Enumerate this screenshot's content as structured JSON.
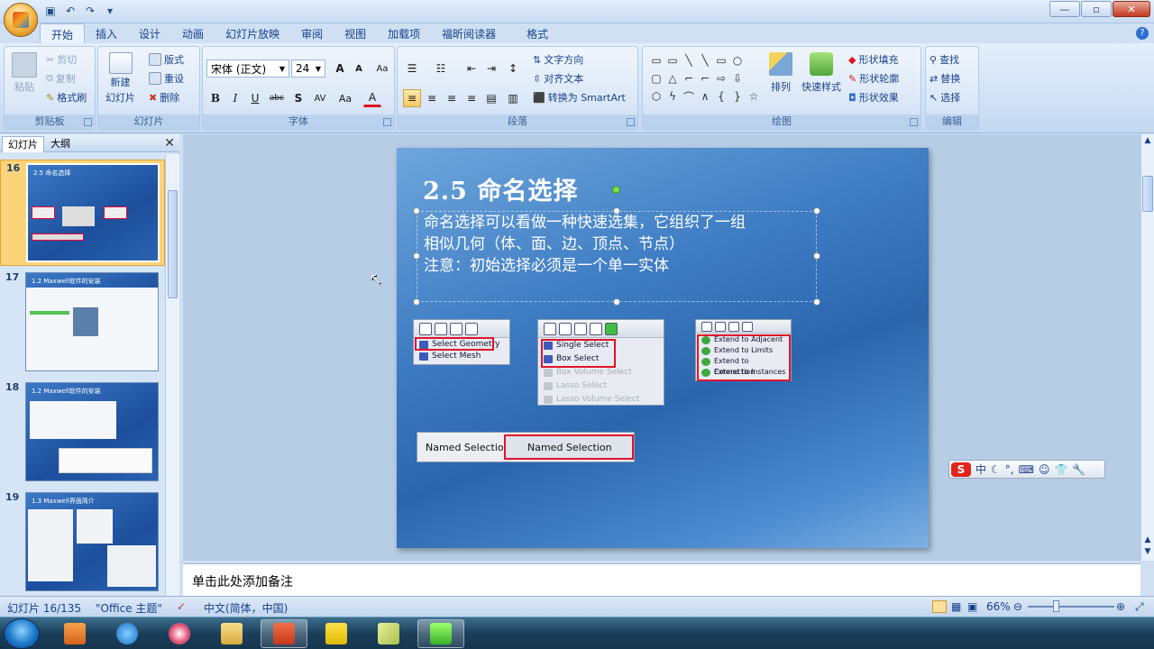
{
  "app": {
    "accent": "#2b66ad",
    "brand_color": "#f2b33d"
  },
  "qat": {
    "items": [
      "save-icon",
      "undo-icon",
      "redo-icon",
      "customize-icon"
    ]
  },
  "window": {
    "minimize": "—",
    "maximize": "▫",
    "close": "✕"
  },
  "tabs": [
    "开始",
    "插入",
    "设计",
    "动画",
    "幻灯片放映",
    "审阅",
    "视图",
    "加载项",
    "福昕阅读器",
    "格式"
  ],
  "active_tab": "开始",
  "ribbon": {
    "clipboard": {
      "label": "剪贴板",
      "paste": "粘贴",
      "cut": "剪切",
      "copy": "复制",
      "format_painter": "格式刷"
    },
    "slides": {
      "label": "幻灯片",
      "new_slide": "新建",
      "new_slide2": "幻灯片",
      "layout": "版式",
      "reset": "重设",
      "delete": "删除"
    },
    "font": {
      "label": "字体",
      "font_name": "宋体 (正文)",
      "font_size": "24",
      "grow": "A",
      "shrink": "A",
      "clear": "Aa",
      "bold": "B",
      "italic": "I",
      "underline": "U",
      "strike": "abc",
      "shadow": "S",
      "spacing": "AV",
      "case": "Aa",
      "color": "A"
    },
    "paragraph": {
      "label": "段落",
      "text_direction": "文字方向",
      "align_text": "对齐文本",
      "smartart": "转换为 SmartArt"
    },
    "drawing": {
      "label": "绘图",
      "arrange": "排列",
      "quick_styles": "快速样式",
      "shape_fill": "形状填充",
      "shape_outline": "形状轮廓",
      "shape_effects": "形状效果"
    },
    "editing": {
      "label": "编辑",
      "find": "查找",
      "replace": "替换",
      "select": "选择"
    }
  },
  "panel": {
    "tab_slides": "幻灯片",
    "tab_outline": "大纲",
    "close": "✕"
  },
  "thumbnails": [
    {
      "num": "16",
      "title": "2.5 命名选择",
      "selected": true
    },
    {
      "num": "17",
      "title": "1.2 Maxwell软件的安装",
      "selected": false
    },
    {
      "num": "18",
      "title": "1.2 Maxwell软件的安装",
      "selected": false
    },
    {
      "num": "19",
      "title": "1.3 Maxwell界面简介",
      "selected": false
    }
  ],
  "slide": {
    "title": "2.5 命名选择",
    "body_lines": [
      "命名选择可以看做一种快速选集，它组织了一组",
      "相似几何（体、面、边、顶点、节点）",
      "注意：初始选择必须是一个单一实体"
    ],
    "shot1": {
      "items": [
        "Select Geometry",
        "Select Mesh"
      ]
    },
    "shot2": {
      "items": [
        "Single Select",
        "Box Select",
        "Box Volume Select",
        "Lasso Select",
        "Lasso Volume Select"
      ]
    },
    "shot3": {
      "items": [
        "Extend to Adjacent",
        "Extend to Limits",
        "Extend to Connection",
        "Extend to Instances"
      ]
    },
    "shot4": {
      "left": "Named Selection",
      "right": "Named Selection"
    }
  },
  "notes": {
    "placeholder": "单击此处添加备注"
  },
  "status": {
    "slide_pos": "幻灯片 16/135",
    "theme": "\"Office 主题\"",
    "lang": "中文(简体，中国)",
    "zoom": "66%"
  },
  "ime": {
    "label": "中"
  },
  "taskbar": {
    "items": [
      "start-button",
      "pdf-app",
      "internet-explorer",
      "paint-app",
      "file-explorer",
      "powerpoint",
      "acrobat",
      "notes-app",
      "video-app"
    ]
  }
}
